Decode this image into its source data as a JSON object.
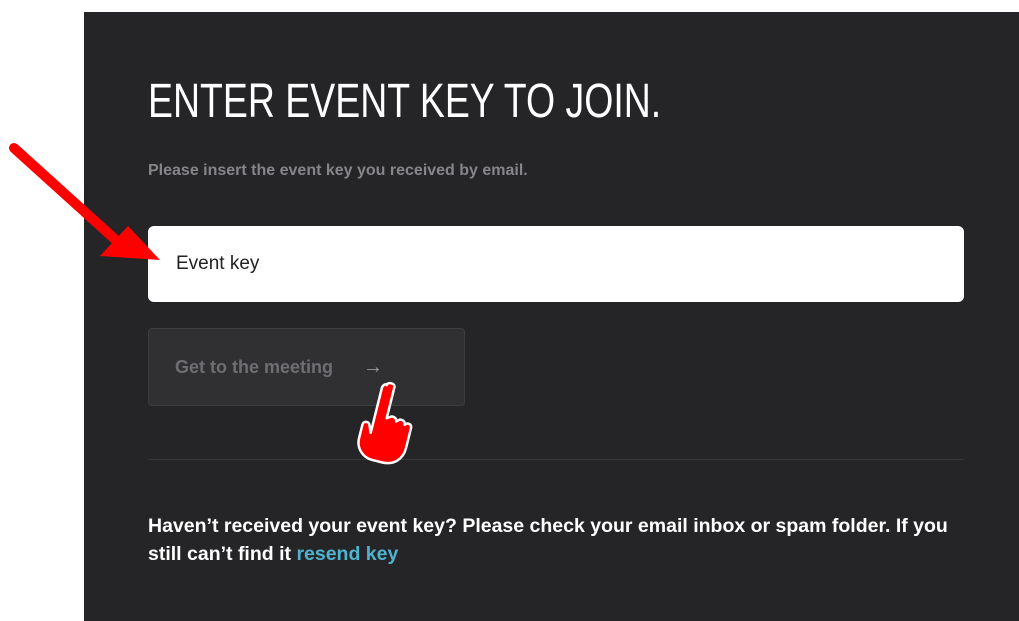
{
  "dialog": {
    "title": "ENTER EVENT KEY TO JOIN.",
    "subtitle": "Please insert the event key you received by email.",
    "input": {
      "placeholder": "Event key",
      "value": ""
    },
    "submit_button": {
      "label": "Get to the meeting",
      "arrow": "→",
      "state": "disabled"
    },
    "help_text": "Haven’t received your event key? Please check your email inbox or spam folder. If you still can’t find it",
    "resend_link": "resend key"
  },
  "annotations": {
    "arrow_color": "#ff0000",
    "pointer_icon": "hand-pointer-icon"
  },
  "colors": {
    "panel_bg": "#252527",
    "link": "#4fb3cf",
    "button_bg": "#303033"
  }
}
